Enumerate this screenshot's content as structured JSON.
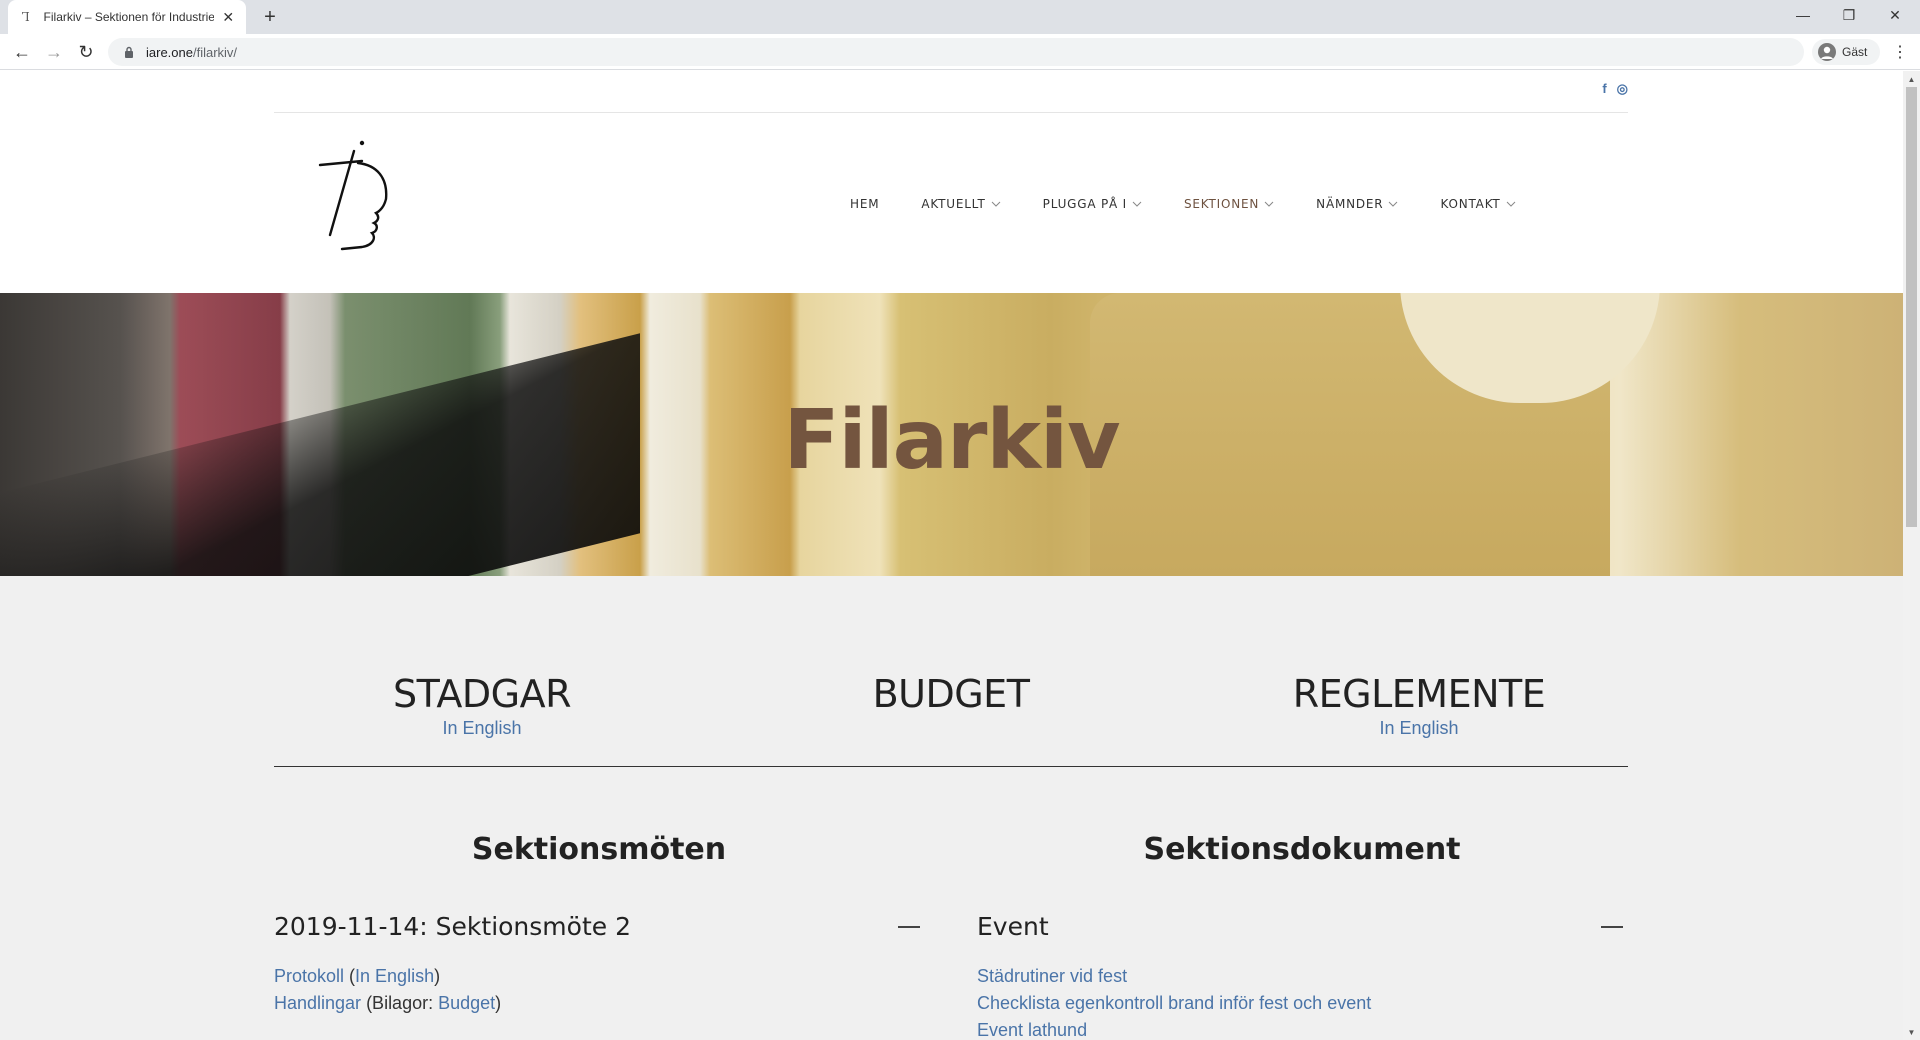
{
  "browser": {
    "tab_favicon": "Ꞁ",
    "tab_title": "Filarkiv – Sektionen för Industriell",
    "url_host": "iare.one",
    "url_path": "/filarkiv/",
    "profile_label": "Gäst"
  },
  "site": {
    "social": [
      "f",
      "◎"
    ],
    "nav": [
      {
        "label": "HEM",
        "dropdown": false
      },
      {
        "label": "AKTUELLT",
        "dropdown": true
      },
      {
        "label": "PLUGGA PÅ I",
        "dropdown": true
      },
      {
        "label": "SEKTIONEN",
        "dropdown": true,
        "active": true
      },
      {
        "label": "NÄMNDER",
        "dropdown": true
      },
      {
        "label": "KONTAKT",
        "dropdown": true
      }
    ],
    "hero_title": "Filarkiv"
  },
  "documents": [
    {
      "title": "STADGAR",
      "sub": "In English"
    },
    {
      "title": "BUDGET",
      "sub": ""
    },
    {
      "title": "REGLEMENTE",
      "sub": "In English"
    }
  ],
  "meetings": {
    "heading": "Sektionsmöten",
    "item_title": "2019-11-14: Sektionsmöte 2",
    "line1": {
      "link1": "Protokoll",
      "open": " (",
      "link2": "In English",
      "close": ")"
    },
    "line2": {
      "link1": "Handlingar",
      "mid": " (Bilagor: ",
      "link2": "Budget",
      "close": ")"
    }
  },
  "section_docs": {
    "heading": "Sektionsdokument",
    "item_title": "Event",
    "links": [
      "Städrutiner vid fest",
      "Checklista egenkontroll brand inför fest och event",
      "Event lathund"
    ]
  },
  "colors": {
    "accent": "#6e5240",
    "link": "#4a74a8",
    "content_bg": "#f0f0f0"
  }
}
